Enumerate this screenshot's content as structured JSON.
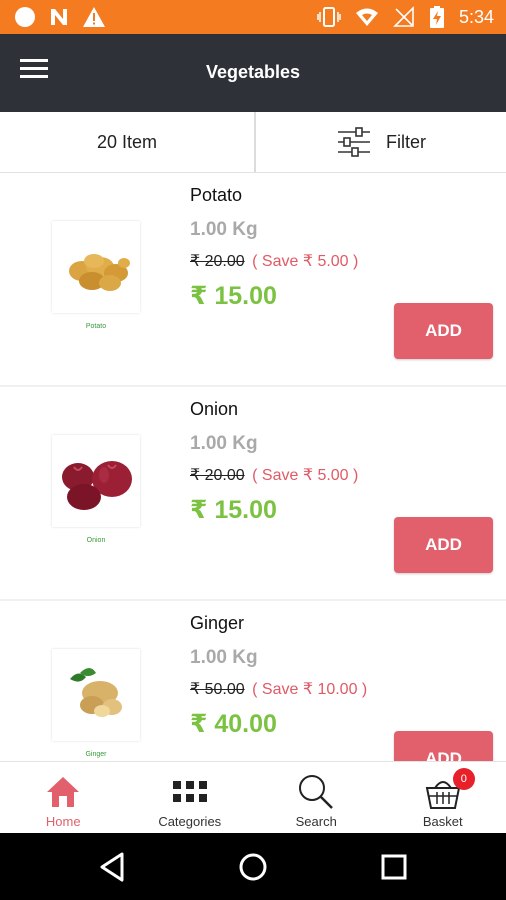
{
  "status_bar": {
    "time": "5:34"
  },
  "toolbar": {
    "title": "Vegetables",
    "menu_icon": "hamburger-menu-icon"
  },
  "filter_bar": {
    "item_count": "20 Item",
    "filter_label": "Filter",
    "filter_icon": "sliders-icon"
  },
  "products": [
    {
      "name": "Potato",
      "quantity": "1.00 Kg",
      "old_price": "₹ 20.00",
      "save": "( Save ₹ 5.00 )",
      "price": "₹ 15.00",
      "caption": "Potato",
      "add_label": "ADD"
    },
    {
      "name": "Onion",
      "quantity": "1.00 Kg",
      "old_price": "₹ 20.00",
      "save": "( Save ₹ 5.00 )",
      "price": "₹ 15.00",
      "caption": "Onion",
      "add_label": "ADD"
    },
    {
      "name": "Ginger",
      "quantity": "1.00 Kg",
      "old_price": "₹ 50.00",
      "save": "( Save ₹ 10.00 )",
      "price": "₹ 40.00",
      "caption": "Ginger",
      "add_label": "ADD"
    }
  ],
  "bottom_nav": {
    "items": [
      {
        "label": "Home",
        "icon": "home-icon",
        "active": true
      },
      {
        "label": "Categories",
        "icon": "grid-icon",
        "active": false
      },
      {
        "label": "Search",
        "icon": "search-icon",
        "active": false
      },
      {
        "label": "Basket",
        "icon": "basket-icon",
        "active": false,
        "badge": "0"
      }
    ]
  },
  "colors": {
    "status_bar": "#f47b20",
    "toolbar": "#2e3238",
    "accent": "#e2606c",
    "price": "#7cc242",
    "save": "#e05a65"
  }
}
